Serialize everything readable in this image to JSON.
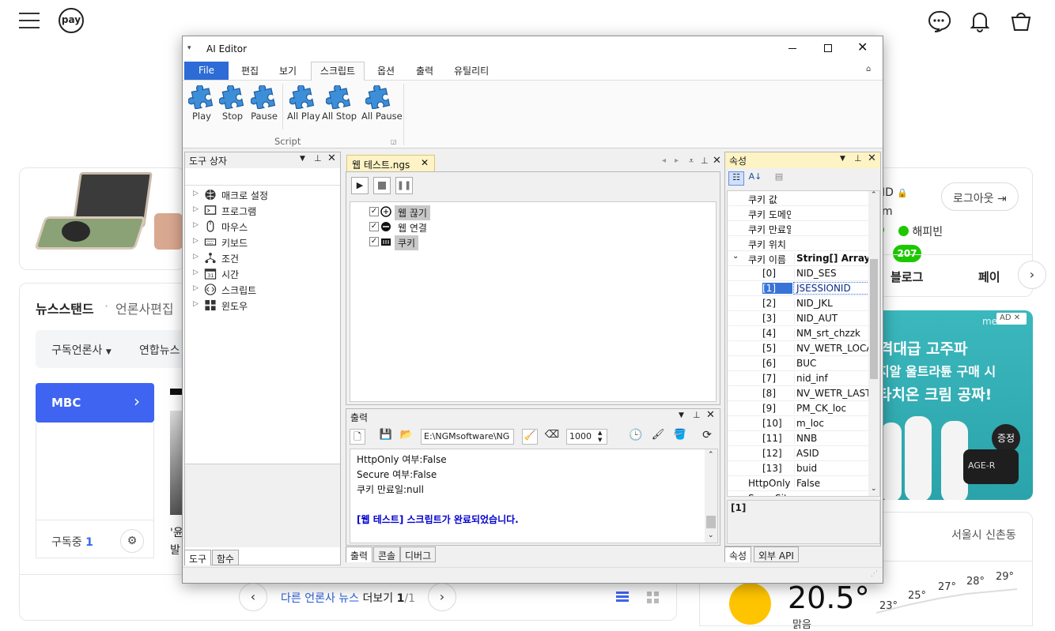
{
  "bg": {
    "pay_label": "pay",
    "news_title": "뉴스스탠드",
    "news_sep": "·",
    "news_sub": "언론사편집",
    "sub_dropdown": "구독언론사",
    "yonhap": "연합뉴스",
    "mbc": "MBC",
    "mbc_chev": "›",
    "subscribed_label": "구독중",
    "subscribed_count": "1",
    "frag1": "'윤",
    "frag2": "발",
    "more_news_link": "다른 언론사 뉴스",
    "more_news_rest": "더보기",
    "page_cur": "1",
    "page_total": "/1",
    "id_frag": "ID",
    "m_frag": "m",
    "logout": "로그아웃",
    "happybean": "해피빈",
    "badge_207": "207",
    "blog": "블로그",
    "pay2": "페이",
    "ad_line1": "격대급 고주파",
    "ad_line2": "지알 울트라튠 구매 시",
    "ad_line3": "타치온 크림 공짜!",
    "ad_brand": "medi",
    "ad_badge": "AD",
    "ad_product": "AGE-R",
    "ad_gift": "증정",
    "location": "서울시 신촌동",
    "temp_now": "20.5°",
    "temp_desc": "맑음",
    "temps": [
      "23°",
      "25°",
      "27°",
      "28°",
      "29°"
    ]
  },
  "win": {
    "title": "AI Editor",
    "menu": [
      "File",
      "편집",
      "보기",
      "스크립트",
      "옵션",
      "출력",
      "유틸리티"
    ],
    "ribbon_buttons": [
      "Play",
      "Stop",
      "Pause",
      "All Play",
      "All Stop",
      "All Pause"
    ],
    "ribbon_group": "Script",
    "toolbox": {
      "title": "도구 상자",
      "items": [
        "매크로 설정",
        "프로그램",
        "마우스",
        "키보드",
        "조건",
        "시간",
        "스크립트",
        "윈도우"
      ],
      "tabs": [
        "도구",
        "함수"
      ]
    },
    "doc": {
      "tab": "웹 테스트.ngs",
      "nodes": [
        "웹 끊기",
        "웹 연결",
        "쿠키"
      ]
    },
    "output": {
      "title": "출력",
      "path": "E:\\NGMsoftware\\NG",
      "count": "1000",
      "lines": [
        "HttpOnly 여부:False",
        "Secure 여부:False",
        "쿠키 만료일:null",
        "",
        "[웹 테스트] 스크립트가 완료되었습니다."
      ],
      "tabs": [
        "출력",
        "콘솔",
        "디버그"
      ]
    },
    "props": {
      "title": "속성",
      "rows": [
        {
          "n": "쿠키 값",
          "v": ""
        },
        {
          "n": "쿠키 도메인",
          "v": ""
        },
        {
          "n": "쿠키 만료일",
          "v": ""
        },
        {
          "n": "쿠키 위치",
          "v": ""
        },
        {
          "n": "쿠키 이름",
          "v": "String[] Array"
        },
        {
          "n": "[0]",
          "v": "NID_SES"
        },
        {
          "n": "[1]",
          "v": "JSESSIONID"
        },
        {
          "n": "[2]",
          "v": "NID_JKL"
        },
        {
          "n": "[3]",
          "v": "NID_AUT"
        },
        {
          "n": "[4]",
          "v": "NM_srt_chzzk"
        },
        {
          "n": "[5]",
          "v": "NV_WETR_LOCAT"
        },
        {
          "n": "[6]",
          "v": "BUC"
        },
        {
          "n": "[7]",
          "v": "nid_inf"
        },
        {
          "n": "[8]",
          "v": "NV_WETR_LAST_A"
        },
        {
          "n": "[9]",
          "v": "PM_CK_loc"
        },
        {
          "n": "[10]",
          "v": "m_loc"
        },
        {
          "n": "[11]",
          "v": "NNB"
        },
        {
          "n": "[12]",
          "v": "ASID"
        },
        {
          "n": "[13]",
          "v": "buid"
        },
        {
          "n": "HttpOnly",
          "v": "False"
        },
        {
          "n": "SameSite",
          "v": ""
        }
      ],
      "desc": "[1]",
      "tabs": [
        "속성",
        "외부 API"
      ]
    }
  }
}
